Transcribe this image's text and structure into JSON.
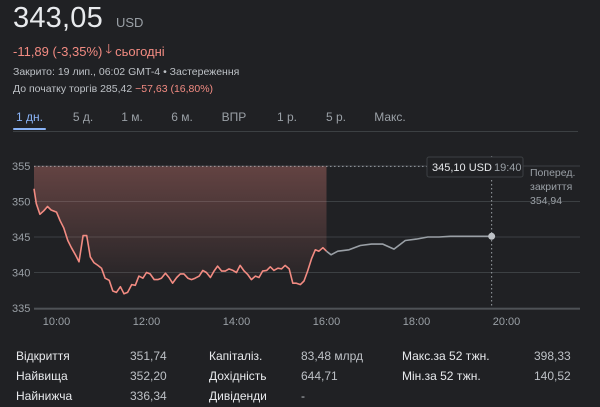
{
  "quote": {
    "price": "343,05",
    "currency": "USD",
    "change_text": "-11,89 (-3,35%)",
    "change_suffix": "сьогодні",
    "closed_label": "Закрито: 19 лип., 06:02 GMT-4 • Застереження",
    "premarket_label": "До початку торгів 285,42",
    "premarket_change": "−57,63 (16,80%)"
  },
  "tabs": [
    {
      "label": "1 дн.",
      "active": true
    },
    {
      "label": "5 д.",
      "active": false
    },
    {
      "label": "1 м.",
      "active": false
    },
    {
      "label": "6 м.",
      "active": false
    },
    {
      "label": "ВПР",
      "active": false
    },
    {
      "label": "1 р.",
      "active": false
    },
    {
      "label": "5 р.",
      "active": false
    },
    {
      "label": "Макс.",
      "active": false
    }
  ],
  "tooltip": {
    "price": "345,10 USD",
    "time": "19:40"
  },
  "prev_close": {
    "line1": "Поперед.",
    "line2": "закриття",
    "value": "354,94"
  },
  "colors": {
    "down": "#f28b82",
    "after_hours": "#9aa0a6",
    "accent": "#8ab4f8"
  },
  "chart_data": {
    "type": "line",
    "x_unit": "hour",
    "ylim": [
      335,
      355
    ],
    "xlim": [
      9.5,
      20.9
    ],
    "yticks": [
      355,
      350,
      345,
      340,
      335
    ],
    "ytick_labels": [
      "355",
      "350",
      "345",
      "340",
      "335"
    ],
    "xticks": [
      10,
      12,
      14,
      16,
      18,
      20
    ],
    "xtick_labels": [
      "10:00",
      "12:00",
      "14:00",
      "16:00",
      "18:00",
      "20:00"
    ],
    "previous_close": 354.94,
    "grid": true,
    "series": [
      {
        "session": "regular",
        "color": "#f28b82",
        "x": [
          9.5,
          9.55,
          9.63,
          9.72,
          9.8,
          9.88,
          10.0,
          10.08,
          10.16,
          10.25,
          10.33,
          10.42,
          10.5,
          10.59,
          10.67,
          10.75,
          10.83,
          10.92,
          11.0,
          11.08,
          11.17,
          11.25,
          11.33,
          11.42,
          11.5,
          11.58,
          11.67,
          11.75,
          11.83,
          11.92,
          12.0,
          12.08,
          12.17,
          12.25,
          12.33,
          12.42,
          12.5,
          12.58,
          12.67,
          12.75,
          12.83,
          12.92,
          13.0,
          13.08,
          13.17,
          13.25,
          13.33,
          13.42,
          13.5,
          13.58,
          13.67,
          13.75,
          13.83,
          13.92,
          14.0,
          14.08,
          14.17,
          14.25,
          14.33,
          14.42,
          14.5,
          14.58,
          14.67,
          14.75,
          14.83,
          14.92,
          15.0,
          15.08,
          15.17,
          15.25,
          15.33,
          15.42,
          15.5,
          15.58,
          15.67,
          15.75,
          15.83,
          15.92,
          16.0
        ],
        "y": [
          351.8,
          349.7,
          348.2,
          348.7,
          349.3,
          348.8,
          348.5,
          347.3,
          346.3,
          344.5,
          343.5,
          342.5,
          341.5,
          345.2,
          345.2,
          342.2,
          341.4,
          341.0,
          340.6,
          339.2,
          338.9,
          337.4,
          337.2,
          338.0,
          337.0,
          337.2,
          338.3,
          338.2,
          339.5,
          339.2,
          340.0,
          339.8,
          339.0,
          339.0,
          339.2,
          339.9,
          339.3,
          338.5,
          339.3,
          339.8,
          339.8,
          339.2,
          339.0,
          339.2,
          339.5,
          340.3,
          340.0,
          339.3,
          340.2,
          340.9,
          340.2,
          340.2,
          340.5,
          340.3,
          340.0,
          341.0,
          340.2,
          339.7,
          339.0,
          339.5,
          339.3,
          340.2,
          340.3,
          340.8,
          340.3,
          340.6,
          340.5,
          341.0,
          340.5,
          338.5,
          338.5,
          338.3,
          338.8,
          340.2,
          342.0,
          343.2,
          343.0,
          343.5,
          343.0
        ],
        "fill": true
      },
      {
        "session": "after_hours",
        "color": "#9aa0a6",
        "x": [
          16.0,
          16.1,
          16.25,
          16.5,
          16.75,
          17.0,
          17.25,
          17.5,
          17.75,
          18.0,
          18.25,
          18.5,
          18.75,
          19.0,
          19.25,
          19.5,
          19.67
        ],
        "y": [
          343.0,
          342.5,
          343.0,
          343.2,
          343.8,
          344.0,
          344.0,
          343.3,
          344.5,
          344.7,
          345.0,
          345.0,
          345.1,
          345.1,
          345.1,
          345.1,
          345.1
        ]
      }
    ],
    "last_point": {
      "x": 19.67,
      "y": 345.1
    }
  },
  "stats": [
    {
      "label": "Відкриття",
      "value": "351,74"
    },
    {
      "label": "Найвища",
      "value": "352,20"
    },
    {
      "label": "Найнижча",
      "value": "336,34"
    },
    {
      "label": "Капіталіз.",
      "value": "83,48 млрд"
    },
    {
      "label": "Дохідність",
      "value": "644,71"
    },
    {
      "label": "Дивіденди",
      "value": "-"
    },
    {
      "label": "Макс.за 52 тжн.",
      "value": "398,33"
    },
    {
      "label": "Мін.за 52 тжн.",
      "value": "140,52"
    }
  ]
}
